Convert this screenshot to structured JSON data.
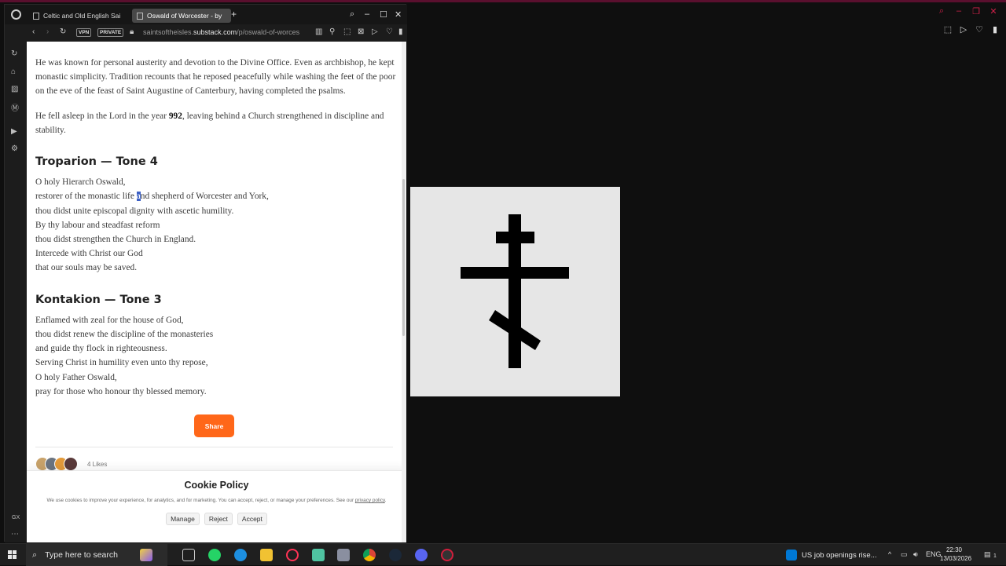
{
  "browser": {
    "tabs": [
      {
        "label": "Celtic and Old English Sai"
      },
      {
        "label": "Oswald of Worcester - by"
      }
    ],
    "vpn_label": "VPN",
    "private_label": "PRIVATE",
    "url_domain": "saintsoftheisles.",
    "url_host": "substack.com",
    "url_path": "/p/oswald-of-worces",
    "sidebar_badge": "GX"
  },
  "article": {
    "para1": "He was known for personal austerity and devotion to the Divine Office. Even as archbishop, he kept monastic simplicity. Tradition recounts that he reposed peacefully while washing the feet of the poor on the eve of the feast of Saint Augustine of Canterbury, having completed the psalms.",
    "para2_before": "He fell asleep in the Lord in the year ",
    "para2_year": "992",
    "para2_after": ", leaving behind a Church strengthened in discipline and stability.",
    "troparion_title": "Troparion — Tone 4",
    "troparion_l1": "O holy Hierarch Oswald,",
    "troparion_l2a": "restorer of the monastic life ",
    "troparion_l2_selected": "a",
    "troparion_l2b": "nd shepherd of Worcester and York,",
    "troparion_l3": "thou didst unite episcopal dignity with ascetic humility.",
    "troparion_l4": "By thy labour and steadfast reform",
    "troparion_l5": "thou didst strengthen the Church in England.",
    "troparion_l6": "Intercede with Christ our God",
    "troparion_l7": "that our souls may be saved.",
    "kontakion_title": "Kontakion — Tone 3",
    "kontakion_lines": [
      "Enflamed with zeal for the house of God,",
      "thou didst renew the discipline of the monasteries",
      "and guide thy flock in righteousness.",
      "Serving Christ in humility even unto thy repose,",
      "O holy Father Oswald,",
      "pray for those who honour thy blessed memory."
    ],
    "share_label": "Share",
    "likes_label": "4 Likes"
  },
  "cookie": {
    "title": "Cookie Policy",
    "text": "We use cookies to improve your experience, for analytics, and for marketing. You can accept, reject, or manage your preferences. See our",
    "link": "privacy policy",
    "link_end": ".",
    "manage": "Manage",
    "reject": "Reject",
    "accept": "Accept"
  },
  "taskbar": {
    "search_placeholder": "Type here to search",
    "news": "US job openings rise...",
    "lang": "ENG",
    "time": "22:30",
    "date": "13/03/2026",
    "notif_count": "1"
  },
  "colors": {
    "share": "#ff6719",
    "selection": "#3b5fc4",
    "opera_red": "#d0204a"
  }
}
